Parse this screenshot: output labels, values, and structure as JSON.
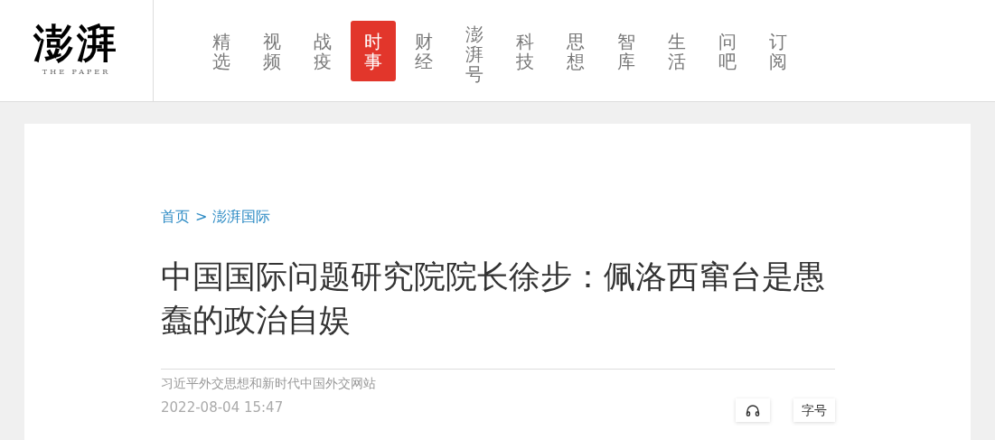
{
  "logo": {
    "name": "澎湃",
    "tagline": "THE PAPER"
  },
  "nav": [
    {
      "label": "精选",
      "selected": false
    },
    {
      "label": "视频",
      "selected": false
    },
    {
      "label": "战疫",
      "selected": false
    },
    {
      "label": "时事",
      "selected": true
    },
    {
      "label": "财经",
      "selected": false
    },
    {
      "label": "澎湃号",
      "selected": false
    },
    {
      "label": "科技",
      "selected": false
    },
    {
      "label": "思想",
      "selected": false
    },
    {
      "label": "智库",
      "selected": false
    },
    {
      "label": "生活",
      "selected": false
    },
    {
      "label": "问吧",
      "selected": false
    },
    {
      "label": "订阅",
      "selected": false
    }
  ],
  "breadcrumb": {
    "home": "首页",
    "separator": ">",
    "section": "澎湃国际"
  },
  "article": {
    "title": "中国国际问题研究院院长徐步：佩洛西窜台是愚蠢的政治自娱",
    "source": "习近平外交思想和新时代中国外交网站",
    "date": "2022-08-04 15:47",
    "font_button": "字号"
  }
}
